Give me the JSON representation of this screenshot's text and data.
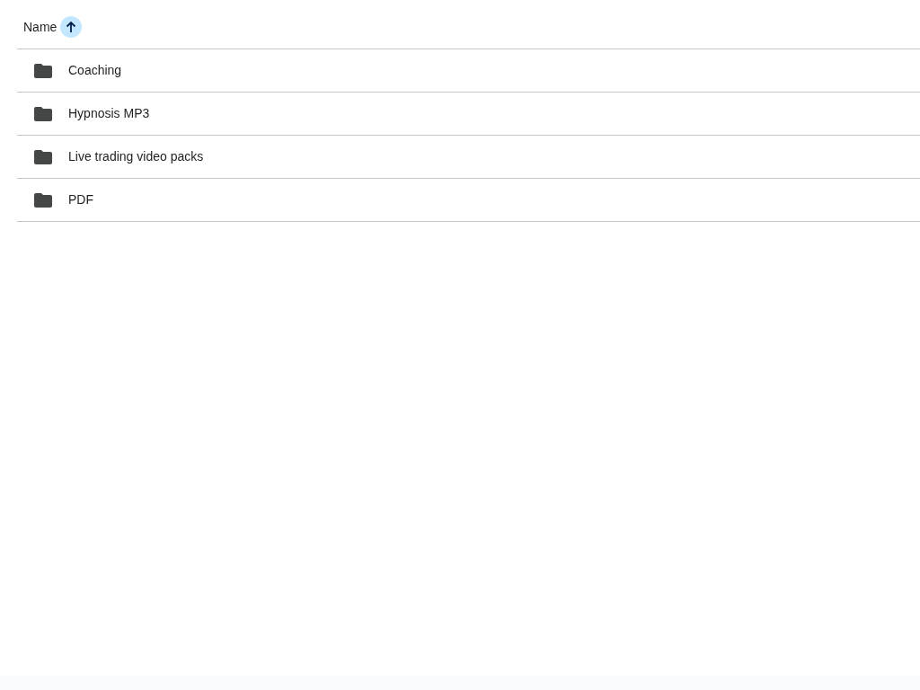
{
  "header": {
    "column": "Name",
    "sort_ascending": true
  },
  "folders": [
    {
      "name": "Coaching"
    },
    {
      "name": "Hypnosis MP3"
    },
    {
      "name": "Live trading video packs"
    },
    {
      "name": "PDF"
    }
  ]
}
